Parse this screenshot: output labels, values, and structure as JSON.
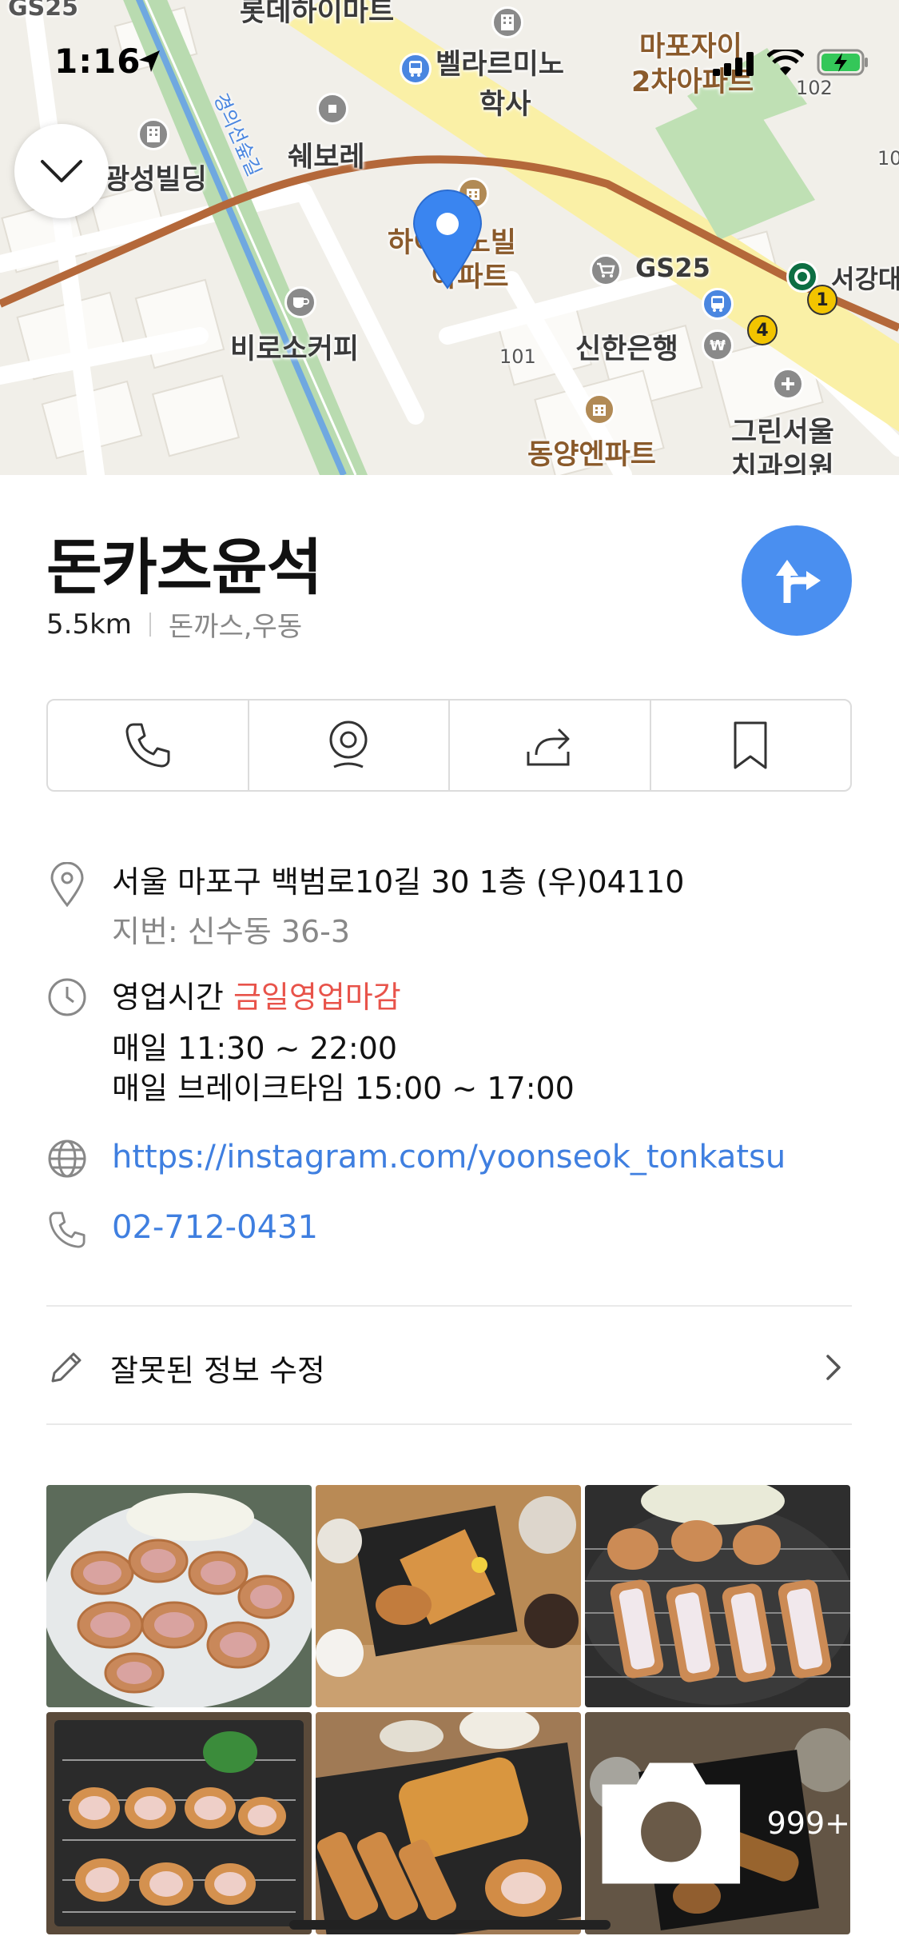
{
  "status_bar": {
    "time": "1:16"
  },
  "map": {
    "labels": {
      "top_left": "GS25",
      "top_center": "롯데하이마트",
      "bellarimino": "벨라르미노",
      "dorm": "학사",
      "mapo_xi": "마포자이",
      "mapo_xi2": "2차아파트",
      "building": "광성빌딩",
      "showboree": "쉐보레",
      "rail": "경의선숲길",
      "apt": "하이크노빌",
      "apt2": "아파트",
      "gs25": "GS25",
      "starbucks": "서강대",
      "biro": "비로소커피",
      "shinhan": "신한은행",
      "dongyang": "동양엔파트",
      "green": "그린서울",
      "dental": "치과의원",
      "num101": "101",
      "num102": "102",
      "num10": "10"
    }
  },
  "place": {
    "name": "돈카츠윤석",
    "distance": "5.5km",
    "category": "돈까스,우동"
  },
  "actions": [
    {
      "id": "call",
      "icon": "phone-icon"
    },
    {
      "id": "roadview",
      "icon": "roadview-icon"
    },
    {
      "id": "share",
      "icon": "share-icon"
    },
    {
      "id": "save",
      "icon": "bookmark-icon"
    }
  ],
  "details": {
    "address": "서울 마포구 백범로10길 30 1층 (우)04110",
    "lot_address": "지번: 신수동 36-3",
    "hours_label": "영업시간",
    "hours_status": "금일영업마감",
    "hours_daily": "매일 11:30 ~ 22:00",
    "hours_break": "매일 브레이크타임 15:00 ~ 17:00",
    "website": "https://instagram.com/yoonseok_tonkatsu",
    "phone": "02-712-0431"
  },
  "edit": {
    "label": "잘못된 정보 수정"
  },
  "photos": {
    "more_count": "999+"
  },
  "colors": {
    "accent": "#4a8ff0",
    "closed": "#e8534a",
    "link": "#3f7fe0"
  }
}
